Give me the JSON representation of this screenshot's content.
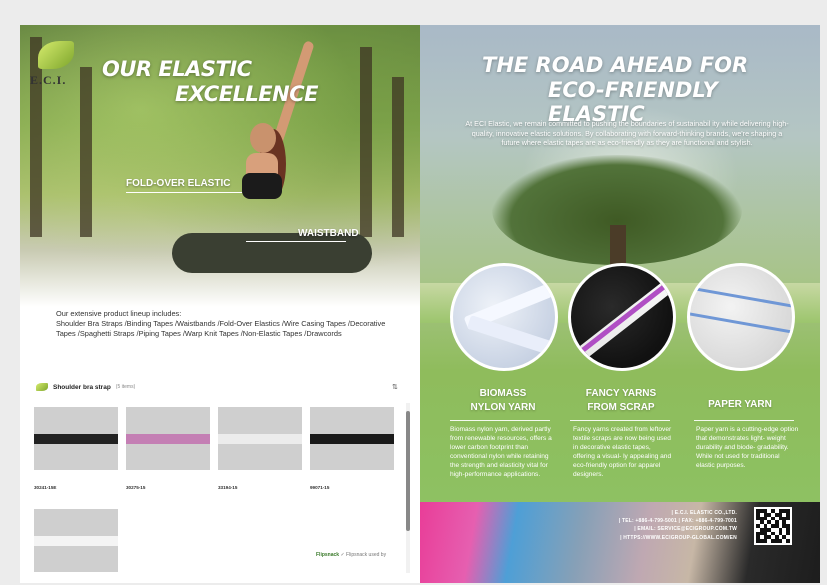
{
  "left_page": {
    "logo_text": "E.C.I.",
    "title_line1": "OUR ELASTIC",
    "title_line2": "EXCELLENCE",
    "callout_foldover": "FOLD-OVER ELASTIC",
    "callout_waistband": "WAISTBAND",
    "intro_line1": "Our extensive product lineup includes:",
    "intro_line2": "Shoulder Bra Straps /Binding Tapes /Waistbands /Fold-Over Elastics /Wire Casing Tapes /Decorative Tapes /Spaghetti Straps /Piping Tapes /Warp Knit Tapes /Non-Elastic Tapes /Drawcords"
  },
  "widget": {
    "category": "Shoulder bra strap",
    "count": "(5 items)",
    "sort_icon": "sort-icon",
    "products": [
      {
        "code": "30241-15E",
        "color": "#222222"
      },
      {
        "code": "30275-15",
        "color": "#c47fb4"
      },
      {
        "code": "33194-15",
        "color": "#ececec"
      },
      {
        "code": "99071-15",
        "color": "#1a1a1a"
      },
      {
        "code": "",
        "color": "#f4f4f4"
      }
    ],
    "footer_brand": "Flipsnack",
    "footer_note": "✓ Flipsnack used by"
  },
  "right_page": {
    "title_line1": "THE ROAD AHEAD FOR",
    "title_line2": "ECO-FRIENDLY ELASTIC",
    "body": "At ECI Elastic, we remain committed to pushing the boundaries of sustainabil ity while delivering high-quality, innovative elastic solutions. By collaborating with forward-thinking brands, we're shaping a future where elastic tapes are as eco-friendly as they are functional and stylish.",
    "yarns": [
      {
        "title_line1": "BIOMASS",
        "title_line2": "NYLON YARN",
        "desc": "Biomass nylon yarn, derived partly from renewable resources, offers a lower carbon footprint than conventional nylon while retaining the strength and elasticity vital for high-performance applications."
      },
      {
        "title_line1": "FANCY YARNS",
        "title_line2": "FROM SCRAP",
        "desc": "Fancy yarns created from leftover textile scraps are now being used in decorative elastic tapes, offering a visual- ly appealing and eco-friendly option for apparel designers."
      },
      {
        "title_line1": "PAPER YARN",
        "title_line2": "",
        "desc": "Paper yarn is a cutting-edge option that demonstrates light- weight durability and biode- gradability. While not used for traditional elastic purposes."
      }
    ],
    "contact": {
      "company": "| E.C.I. ELASTIC CO.,LTD.",
      "phone": "| TEL: +886-4-799-5001 | FAX: +886-4-799-7001",
      "email": "| EMAIL: SERVICE@ECIGROUP.COM.TW",
      "web": "| HTTPS://WWW.ECIGROUP-GLOBAL.COM/EN"
    }
  }
}
